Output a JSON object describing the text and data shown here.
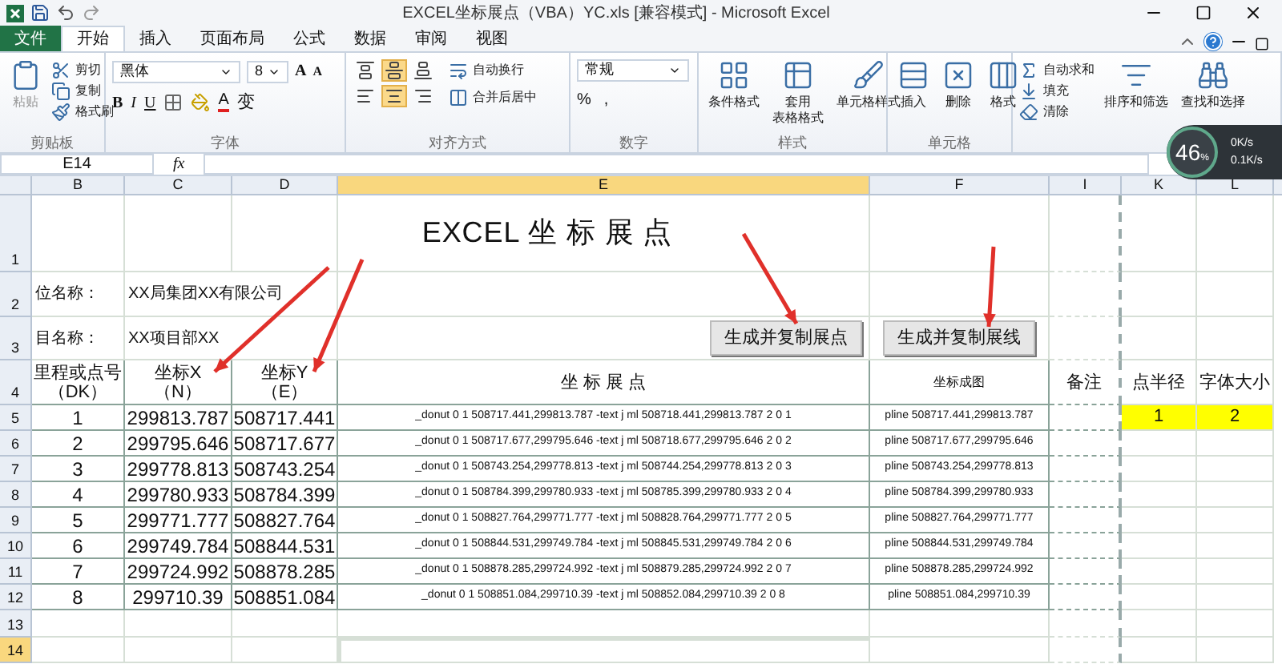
{
  "window": {
    "title": "EXCEL坐标展点（VBA）YC.xls  [兼容模式]  -  Microsoft Excel"
  },
  "tabs": [
    {
      "label": "文件",
      "kind": "file",
      "selected": false
    },
    {
      "label": "开始",
      "kind": "tab",
      "selected": true
    },
    {
      "label": "插入",
      "kind": "tab",
      "selected": false
    },
    {
      "label": "页面布局",
      "kind": "tab",
      "selected": false
    },
    {
      "label": "公式",
      "kind": "tab",
      "selected": false
    },
    {
      "label": "数据",
      "kind": "tab",
      "selected": false
    },
    {
      "label": "审阅",
      "kind": "tab",
      "selected": false
    },
    {
      "label": "视图",
      "kind": "tab",
      "selected": false
    }
  ],
  "ribbon": {
    "clipboard": {
      "label": "剪贴板",
      "paste": {
        "label": "粘贴",
        "disabled": true
      },
      "items": [
        "剪切",
        "复制",
        "格式刷"
      ]
    },
    "font": {
      "label": "字体",
      "font": "黑体",
      "size": "8",
      "size_buttons": [
        "A",
        "A"
      ],
      "format_buttons": [
        "B",
        "I",
        "U"
      ],
      "font_color": "A",
      "phonetic": "变"
    },
    "alignment": {
      "label": "对齐方式",
      "buttons": [
        {
          "kind": "top",
          "selected": false
        },
        {
          "kind": "middle",
          "selected": true
        },
        {
          "kind": "bottom",
          "selected": false
        },
        {
          "kind": "left",
          "selected": false
        },
        {
          "kind": "center",
          "selected": true
        },
        {
          "kind": "right",
          "selected": false
        }
      ],
      "wrap": "自动换行",
      "merge": "合并后居中"
    },
    "number": {
      "label": "数字",
      "format": "常规",
      "symbols": [
        "%",
        ","
      ]
    },
    "styles": {
      "label": "样式",
      "items": [
        {
          "lines": [
            "条件格式"
          ]
        },
        {
          "lines": [
            "套用",
            "表格格式"
          ]
        },
        {
          "lines": [
            "单元格样式"
          ]
        }
      ]
    },
    "cells": {
      "label": "单元格",
      "items": [
        "插入",
        "删除",
        "格式"
      ]
    },
    "editing": {
      "items": [
        "自动求和",
        "填充",
        "清除"
      ],
      "large": [
        "排序和筛选",
        "查找和选择"
      ]
    }
  },
  "speed_widget": {
    "percent": "46",
    "unit": "%",
    "upload": "0K/s",
    "download": "0.1K/s"
  },
  "formula_bar": {
    "name_box": "E14",
    "function_label": "fx"
  },
  "columns": [
    {
      "label": "B",
      "selected": false
    },
    {
      "label": "C",
      "selected": false
    },
    {
      "label": "D",
      "selected": false
    },
    {
      "label": "E",
      "selected": true
    },
    {
      "label": "F",
      "selected": false
    },
    {
      "label": "I",
      "selected": false
    },
    {
      "label": "K",
      "selected": false
    },
    {
      "label": "L",
      "selected": false
    }
  ],
  "rows": [
    {
      "number": "1",
      "kind": "title",
      "selected": false,
      "cells": [
        null,
        null,
        null,
        "EXCEL 坐 标 展 点",
        null,
        null,
        null,
        null
      ]
    },
    {
      "number": "2",
      "kind": "label",
      "selected": false,
      "cells": [
        "位名称：",
        "XX局集团XX有限公司",
        null,
        null,
        null,
        null,
        null,
        null
      ]
    },
    {
      "number": "3",
      "kind": "label",
      "selected": false,
      "cells": [
        "目名称：",
        "XX项目部XX",
        null,
        {
          "kind": "button",
          "text": "生成并复制展点"
        },
        {
          "kind": "button",
          "text": "生成并复制展线"
        },
        null,
        null,
        null
      ]
    },
    {
      "number": "4",
      "kind": "header",
      "selected": false,
      "cells": [
        "里程或点号（DK）",
        "坐标X（N）",
        "坐标Y（E）",
        "坐  标  展  点",
        "坐标成图",
        "备注",
        "点半径",
        "字体大小"
      ]
    },
    {
      "number": "5",
      "kind": "data",
      "selected": false,
      "cells": [
        "1",
        "299813.787",
        "508717.441",
        "_donut 0 1 508717.441,299813.787  -text j ml 508718.441,299813.787 2 0 1",
        "pline 508717.441,299813.787",
        null,
        {
          "kind": "highlight",
          "text": "1"
        },
        {
          "kind": "highlight",
          "text": "2"
        }
      ]
    },
    {
      "number": "6",
      "kind": "data",
      "selected": false,
      "cells": [
        "2",
        "299795.646",
        "508717.677",
        "_donut 0 1 508717.677,299795.646  -text j ml 508718.677,299795.646 2 0 2",
        "pline 508717.677,299795.646",
        null,
        null,
        null
      ]
    },
    {
      "number": "7",
      "kind": "data",
      "selected": false,
      "cells": [
        "3",
        "299778.813",
        "508743.254",
        "_donut 0 1 508743.254,299778.813  -text j ml 508744.254,299778.813 2 0 3",
        "pline 508743.254,299778.813",
        null,
        null,
        null
      ]
    },
    {
      "number": "8",
      "kind": "data",
      "selected": false,
      "cells": [
        "4",
        "299780.933",
        "508784.399",
        "_donut 0 1 508784.399,299780.933  -text j ml 508785.399,299780.933 2 0 4",
        "pline 508784.399,299780.933",
        null,
        null,
        null
      ]
    },
    {
      "number": "9",
      "kind": "data",
      "selected": false,
      "cells": [
        "5",
        "299771.777",
        "508827.764",
        "_donut 0 1 508827.764,299771.777  -text j ml 508828.764,299771.777 2 0 5",
        "pline 508827.764,299771.777",
        null,
        null,
        null
      ]
    },
    {
      "number": "10",
      "kind": "data",
      "selected": false,
      "cells": [
        "6",
        "299749.784",
        "508844.531",
        "_donut 0 1 508844.531,299749.784  -text j ml 508845.531,299749.784 2 0 6",
        "pline 508844.531,299749.784",
        null,
        null,
        null
      ]
    },
    {
      "number": "11",
      "kind": "data",
      "selected": false,
      "cells": [
        "7",
        "299724.992",
        "508878.285",
        "_donut 0 1 508878.285,299724.992  -text j ml 508879.285,299724.992 2 0 7",
        "pline 508878.285,299724.992",
        null,
        null,
        null
      ]
    },
    {
      "number": "12",
      "kind": "data",
      "selected": false,
      "cells": [
        "8",
        "299710.39",
        "508851.084",
        "_donut 0 1 508851.084,299710.39  -text j ml 508852.084,299710.39 2 0 8",
        "pline 508851.084,299710.39",
        null,
        null,
        null
      ]
    },
    {
      "number": "13",
      "kind": "blank",
      "selected": false,
      "cells": [
        null,
        null,
        null,
        null,
        null,
        null,
        null,
        null
      ]
    },
    {
      "number": "14",
      "kind": "blank",
      "selected": true,
      "cells": [
        null,
        null,
        null,
        null,
        null,
        null,
        null,
        null
      ]
    }
  ]
}
